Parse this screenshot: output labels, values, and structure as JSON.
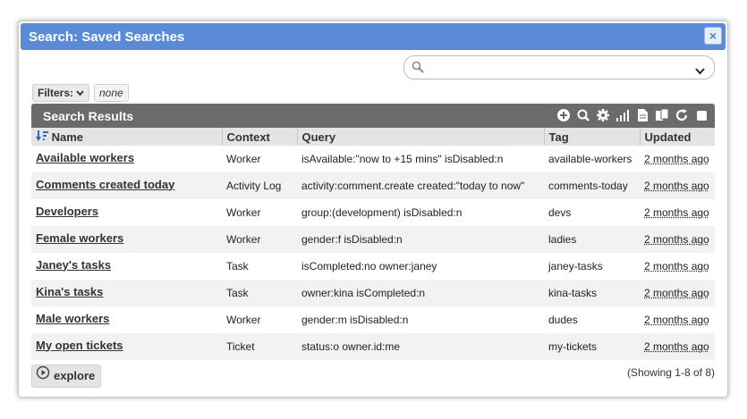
{
  "dialog": {
    "title": "Search: Saved Searches",
    "close_symbol": "×"
  },
  "search": {
    "value": "",
    "placeholder": ""
  },
  "filters": {
    "label": "Filters:",
    "value": "none"
  },
  "results": {
    "title": "Search Results",
    "toolbar_icons": [
      "add-icon",
      "search-icon",
      "gear-icon",
      "chart-icon",
      "document-icon",
      "copy-icon",
      "refresh-icon",
      "checkbox-icon"
    ],
    "columns": [
      "Name",
      "Context",
      "Query",
      "Tag",
      "Updated"
    ],
    "rows": [
      {
        "name": "Available workers",
        "context": "Worker",
        "query": "isAvailable:\"now to +15 mins\" isDisabled:n",
        "tag": "available-workers",
        "updated": "2 months ago"
      },
      {
        "name": "Comments created today",
        "context": "Activity Log",
        "query": "activity:comment.create created:\"today to now\"",
        "tag": "comments-today",
        "updated": "2 months ago"
      },
      {
        "name": "Developers",
        "context": "Worker",
        "query": "group:(development) isDisabled:n",
        "tag": "devs",
        "updated": "2 months ago"
      },
      {
        "name": "Female workers",
        "context": "Worker",
        "query": "gender:f isDisabled:n",
        "tag": "ladies",
        "updated": "2 months ago"
      },
      {
        "name": "Janey's tasks",
        "context": "Task",
        "query": "isCompleted:no owner:janey",
        "tag": "janey-tasks",
        "updated": "2 months ago"
      },
      {
        "name": "Kina's tasks",
        "context": "Task",
        "query": "owner:kina isCompleted:n",
        "tag": "kina-tasks",
        "updated": "2 months ago"
      },
      {
        "name": "Male workers",
        "context": "Worker",
        "query": "gender:m isDisabled:n",
        "tag": "dudes",
        "updated": "2 months ago"
      },
      {
        "name": "My open tickets",
        "context": "Ticket",
        "query": "status:o owner.id:me",
        "tag": "my-tickets",
        "updated": "2 months ago"
      }
    ]
  },
  "footer": {
    "explore_label": "explore",
    "showing": "(Showing 1-8 of 8)"
  },
  "colors": {
    "titlebar": "#5b8ad6",
    "panel_header": "#6b6b6b",
    "sort_icon": "#2a6cc8"
  }
}
